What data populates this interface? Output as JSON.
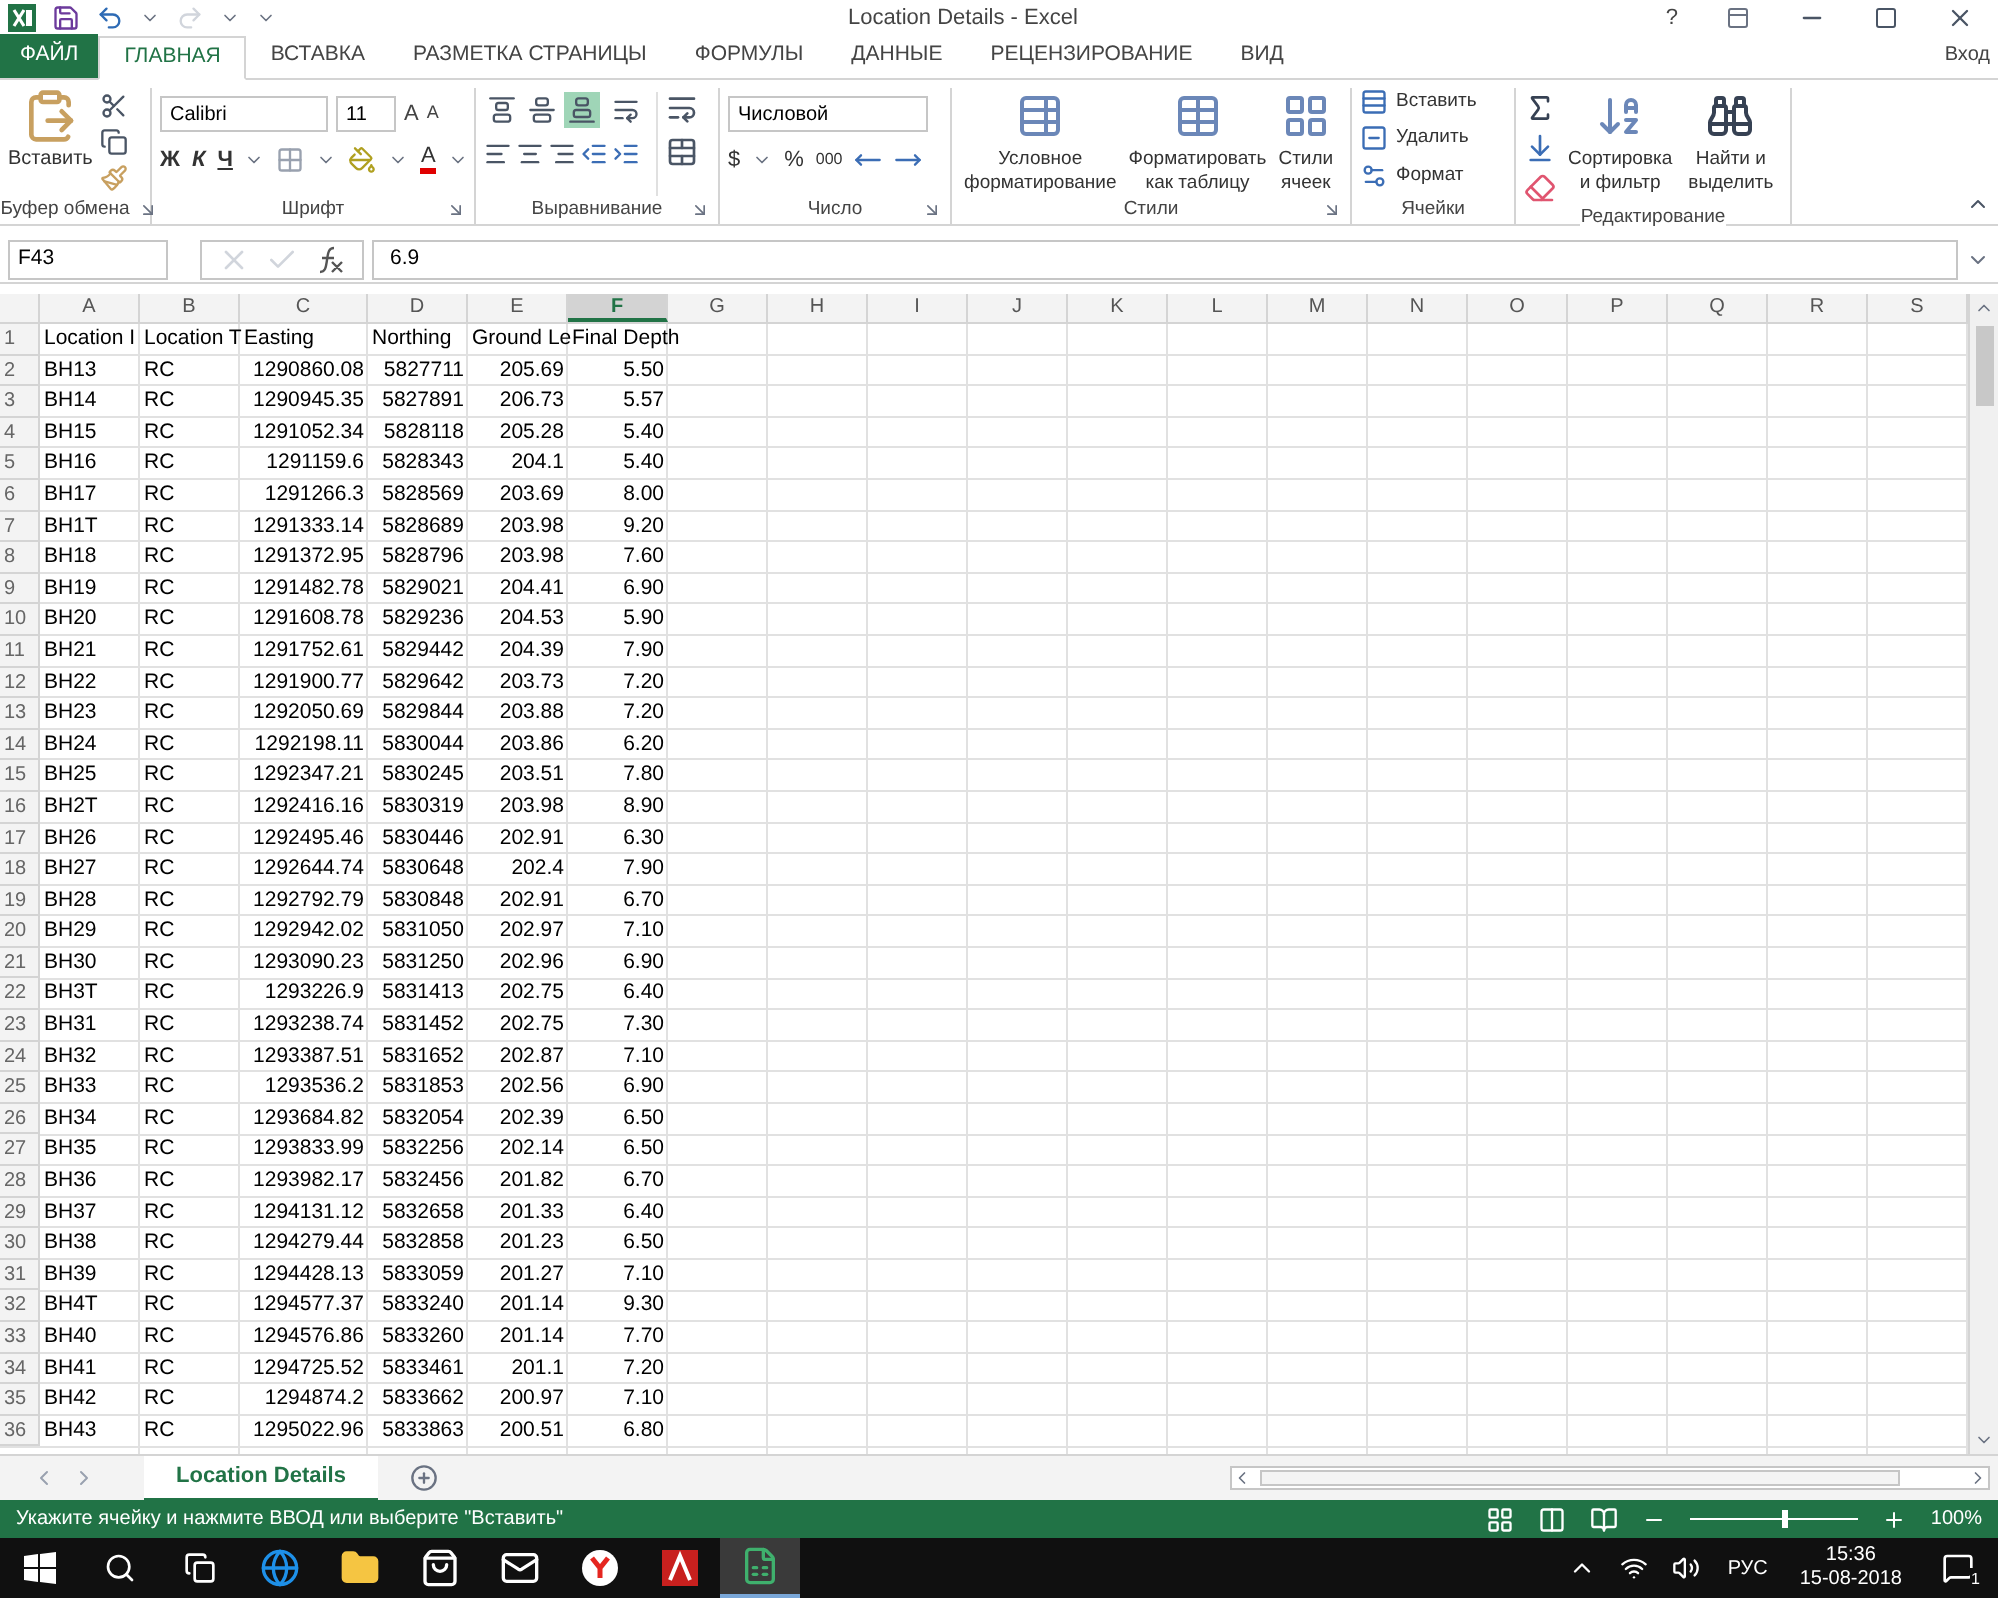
{
  "window": {
    "title": "Location Details - Excel",
    "help": "?",
    "sign_in": "Вход"
  },
  "tabs": [
    {
      "label": "ФАЙЛ",
      "kind": "file",
      "selected": false
    },
    {
      "label": "ГЛАВНАЯ",
      "kind": "tab",
      "selected": true
    },
    {
      "label": "ВСТАВКА",
      "kind": "tab",
      "selected": false
    },
    {
      "label": "РАЗМЕТКА СТРАНИЦЫ",
      "kind": "tab",
      "selected": false
    },
    {
      "label": "ФОРМУЛЫ",
      "kind": "tab",
      "selected": false
    },
    {
      "label": "ДАННЫЕ",
      "kind": "tab",
      "selected": false
    },
    {
      "label": "РЕЦЕНЗИРОВАНИЕ",
      "kind": "tab",
      "selected": false
    },
    {
      "label": "ВИД",
      "kind": "tab",
      "selected": false
    }
  ],
  "ribbon": {
    "clipboard": {
      "label": "Буфер обмена",
      "paste": "Вставить"
    },
    "font": {
      "label": "Шрифт",
      "font_name": "Calibri",
      "font_size": "11",
      "grow": "A",
      "shrink": "A",
      "bold": "Ж",
      "italic": "К",
      "underline": "Ч",
      "font_color": "A"
    },
    "alignment": {
      "label": "Выравнивание",
      "vertical_align": [
        {
          "selected": false
        },
        {
          "selected": false
        },
        {
          "selected": true
        }
      ]
    },
    "number": {
      "label": "Число",
      "format": "Числовой",
      "currency": "$",
      "percent": "%",
      "thousands": "000"
    },
    "styles": {
      "label": "Стили",
      "buttons": [
        {
          "line1": "Условное",
          "line2": "форматирование"
        },
        {
          "line1": "Форматировать",
          "line2": "как таблицу"
        },
        {
          "line1": "Стили",
          "line2": "ячеек"
        }
      ]
    },
    "cells": {
      "label": "Ячейки",
      "buttons": [
        "Вставить",
        "Удалить",
        "Формат"
      ]
    },
    "editing": {
      "label": "Редактирование",
      "sort": {
        "line1": "Сортировка",
        "line2": "и фильтр"
      },
      "find": {
        "line1": "Найти и",
        "line2": "выделить"
      }
    }
  },
  "formula_bar": {
    "name_box": "F43",
    "value": "6.9"
  },
  "sheet": {
    "columns": [
      {
        "label": "A",
        "selected": false
      },
      {
        "label": "B",
        "selected": false
      },
      {
        "label": "C",
        "selected": false
      },
      {
        "label": "D",
        "selected": false
      },
      {
        "label": "E",
        "selected": false
      },
      {
        "label": "F",
        "selected": true
      },
      {
        "label": "G",
        "selected": false
      },
      {
        "label": "H",
        "selected": false
      },
      {
        "label": "I",
        "selected": false
      },
      {
        "label": "J",
        "selected": false
      },
      {
        "label": "K",
        "selected": false
      },
      {
        "label": "L",
        "selected": false
      },
      {
        "label": "M",
        "selected": false
      },
      {
        "label": "N",
        "selected": false
      },
      {
        "label": "O",
        "selected": false
      },
      {
        "label": "P",
        "selected": false
      },
      {
        "label": "Q",
        "selected": false
      },
      {
        "label": "R",
        "selected": false
      },
      {
        "label": "S",
        "selected": false
      }
    ],
    "rows": [
      {
        "number": "1",
        "cells": [
          "Location I",
          "Location T",
          "Easting",
          "Northing",
          "Ground Le",
          "Final Depth"
        ]
      },
      {
        "number": "2",
        "cells": [
          "BH13",
          "RC",
          "1290860.08",
          "5827711",
          "205.69",
          "5.50"
        ]
      },
      {
        "number": "3",
        "cells": [
          "BH14",
          "RC",
          "1290945.35",
          "5827891",
          "206.73",
          "5.57"
        ]
      },
      {
        "number": "4",
        "cells": [
          "BH15",
          "RC",
          "1291052.34",
          "5828118",
          "205.28",
          "5.40"
        ]
      },
      {
        "number": "5",
        "cells": [
          "BH16",
          "RC",
          "1291159.6",
          "5828343",
          "204.1",
          "5.40"
        ]
      },
      {
        "number": "6",
        "cells": [
          "BH17",
          "RC",
          "1291266.3",
          "5828569",
          "203.69",
          "8.00"
        ]
      },
      {
        "number": "7",
        "cells": [
          "BH1T",
          "RC",
          "1291333.14",
          "5828689",
          "203.98",
          "9.20"
        ]
      },
      {
        "number": "8",
        "cells": [
          "BH18",
          "RC",
          "1291372.95",
          "5828796",
          "203.98",
          "7.60"
        ]
      },
      {
        "number": "9",
        "cells": [
          "BH19",
          "RC",
          "1291482.78",
          "5829021",
          "204.41",
          "6.90"
        ]
      },
      {
        "number": "10",
        "cells": [
          "BH20",
          "RC",
          "1291608.78",
          "5829236",
          "204.53",
          "5.90"
        ]
      },
      {
        "number": "11",
        "cells": [
          "BH21",
          "RC",
          "1291752.61",
          "5829442",
          "204.39",
          "7.90"
        ]
      },
      {
        "number": "12",
        "cells": [
          "BH22",
          "RC",
          "1291900.77",
          "5829642",
          "203.73",
          "7.20"
        ]
      },
      {
        "number": "13",
        "cells": [
          "BH23",
          "RC",
          "1292050.69",
          "5829844",
          "203.88",
          "7.20"
        ]
      },
      {
        "number": "14",
        "cells": [
          "BH24",
          "RC",
          "1292198.11",
          "5830044",
          "203.86",
          "6.20"
        ]
      },
      {
        "number": "15",
        "cells": [
          "BH25",
          "RC",
          "1292347.21",
          "5830245",
          "203.51",
          "7.80"
        ]
      },
      {
        "number": "16",
        "cells": [
          "BH2T",
          "RC",
          "1292416.16",
          "5830319",
          "203.98",
          "8.90"
        ]
      },
      {
        "number": "17",
        "cells": [
          "BH26",
          "RC",
          "1292495.46",
          "5830446",
          "202.91",
          "6.30"
        ]
      },
      {
        "number": "18",
        "cells": [
          "BH27",
          "RC",
          "1292644.74",
          "5830648",
          "202.4",
          "7.90"
        ]
      },
      {
        "number": "19",
        "cells": [
          "BH28",
          "RC",
          "1292792.79",
          "5830848",
          "202.91",
          "6.70"
        ]
      },
      {
        "number": "20",
        "cells": [
          "BH29",
          "RC",
          "1292942.02",
          "5831050",
          "202.97",
          "7.10"
        ]
      },
      {
        "number": "21",
        "cells": [
          "BH30",
          "RC",
          "1293090.23",
          "5831250",
          "202.96",
          "6.90"
        ]
      },
      {
        "number": "22",
        "cells": [
          "BH3T",
          "RC",
          "1293226.9",
          "5831413",
          "202.75",
          "6.40"
        ]
      },
      {
        "number": "23",
        "cells": [
          "BH31",
          "RC",
          "1293238.74",
          "5831452",
          "202.75",
          "7.30"
        ]
      },
      {
        "number": "24",
        "cells": [
          "BH32",
          "RC",
          "1293387.51",
          "5831652",
          "202.87",
          "7.10"
        ]
      },
      {
        "number": "25",
        "cells": [
          "BH33",
          "RC",
          "1293536.2",
          "5831853",
          "202.56",
          "6.90"
        ]
      },
      {
        "number": "26",
        "cells": [
          "BH34",
          "RC",
          "1293684.82",
          "5832054",
          "202.39",
          "6.50"
        ]
      },
      {
        "number": "27",
        "cells": [
          "BH35",
          "RC",
          "1293833.99",
          "5832256",
          "202.14",
          "6.50"
        ]
      },
      {
        "number": "28",
        "cells": [
          "BH36",
          "RC",
          "1293982.17",
          "5832456",
          "201.82",
          "6.70"
        ]
      },
      {
        "number": "29",
        "cells": [
          "BH37",
          "RC",
          "1294131.12",
          "5832658",
          "201.33",
          "6.40"
        ]
      },
      {
        "number": "30",
        "cells": [
          "BH38",
          "RC",
          "1294279.44",
          "5832858",
          "201.23",
          "6.50"
        ]
      },
      {
        "number": "31",
        "cells": [
          "BH39",
          "RC",
          "1294428.13",
          "5833059",
          "201.27",
          "7.10"
        ]
      },
      {
        "number": "32",
        "cells": [
          "BH4T",
          "RC",
          "1294577.37",
          "5833240",
          "201.14",
          "9.30"
        ]
      },
      {
        "number": "33",
        "cells": [
          "BH40",
          "RC",
          "1294576.86",
          "5833260",
          "201.14",
          "7.70"
        ]
      },
      {
        "number": "34",
        "cells": [
          "BH41",
          "RC",
          "1294725.52",
          "5833461",
          "201.1",
          "7.20"
        ]
      },
      {
        "number": "35",
        "cells": [
          "BH42",
          "RC",
          "1294874.2",
          "5833662",
          "200.97",
          "7.10"
        ]
      },
      {
        "number": "36",
        "cells": [
          "BH43",
          "RC",
          "1295022.96",
          "5833863",
          "200.51",
          "6.80"
        ]
      }
    ]
  },
  "sheet_tabs": [
    {
      "label": "Location Details",
      "selected": true
    }
  ],
  "status_bar": {
    "message": "Укажите ячейку и нажмите ВВОД или выберите \"Вставить\"",
    "zoom": {
      "level": 0.55,
      "reading": "100%"
    }
  },
  "taskbar": {
    "apps": [
      {
        "kind": "browser-e",
        "selected": false
      },
      {
        "kind": "folder",
        "selected": false
      },
      {
        "kind": "store",
        "selected": false
      },
      {
        "kind": "mail",
        "selected": false
      },
      {
        "kind": "browser-y",
        "selected": false
      },
      {
        "kind": "pdf",
        "selected": false
      },
      {
        "kind": "spreadsheet",
        "selected": true
      }
    ],
    "language": "РУС",
    "time": "15:36",
    "date": "15-08-2018",
    "notifications": "1"
  }
}
